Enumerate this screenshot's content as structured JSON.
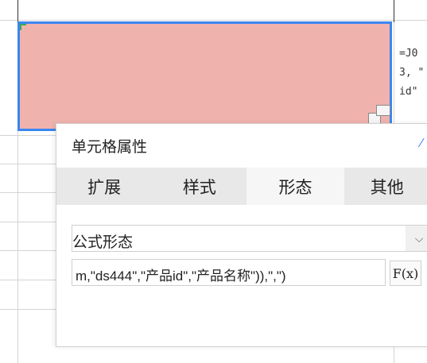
{
  "sheet": {
    "side_text_lines": [
      "=J0",
      "3, \"",
      "id\""
    ]
  },
  "panel": {
    "title": "单元格属性",
    "tabs": [
      "扩展",
      "样式",
      "形态",
      "其他"
    ],
    "active_tab": "形态",
    "select": {
      "value": "公式形态"
    },
    "formula": {
      "value": "m,\"ds444\",\"产品id\",\"产品名称\")),\",\")"
    },
    "fx_label": "F(x)"
  }
}
